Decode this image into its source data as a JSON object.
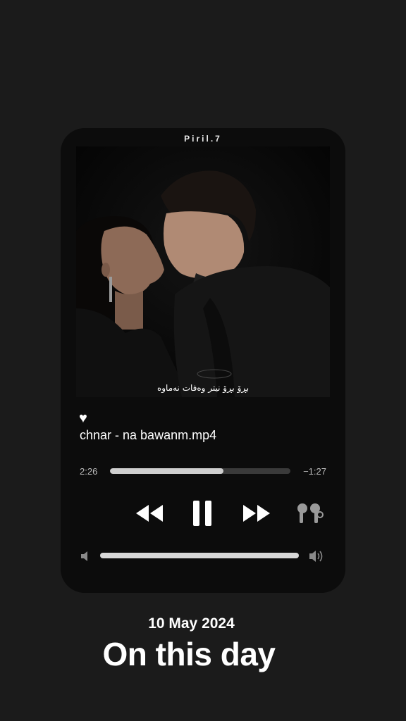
{
  "player": {
    "header_name": "Piril.7",
    "artwork_caption": "بڕۆ بڕۆ نیتر وەفات نەماوە",
    "liked": true,
    "track_title": "chnar - na bawanm.mp4",
    "elapsed": "2:26",
    "remaining": "−1:27",
    "progress": 0.63,
    "volume": 1.0,
    "icons": {
      "like": "heart-icon",
      "rewind": "rewind-icon",
      "pause": "pause-icon",
      "forward": "fast-forward-icon",
      "output": "airpods-icon",
      "volume_low": "speaker-low-icon",
      "volume_high": "speaker-high-icon"
    }
  },
  "footer": {
    "date": "10 May 2024",
    "headline": "On this day"
  },
  "colors": {
    "background": "#1b1b1b",
    "card": "#0c0c0c",
    "progress_fill": "#cfcfcf",
    "progress_track": "#3a3a3a"
  }
}
